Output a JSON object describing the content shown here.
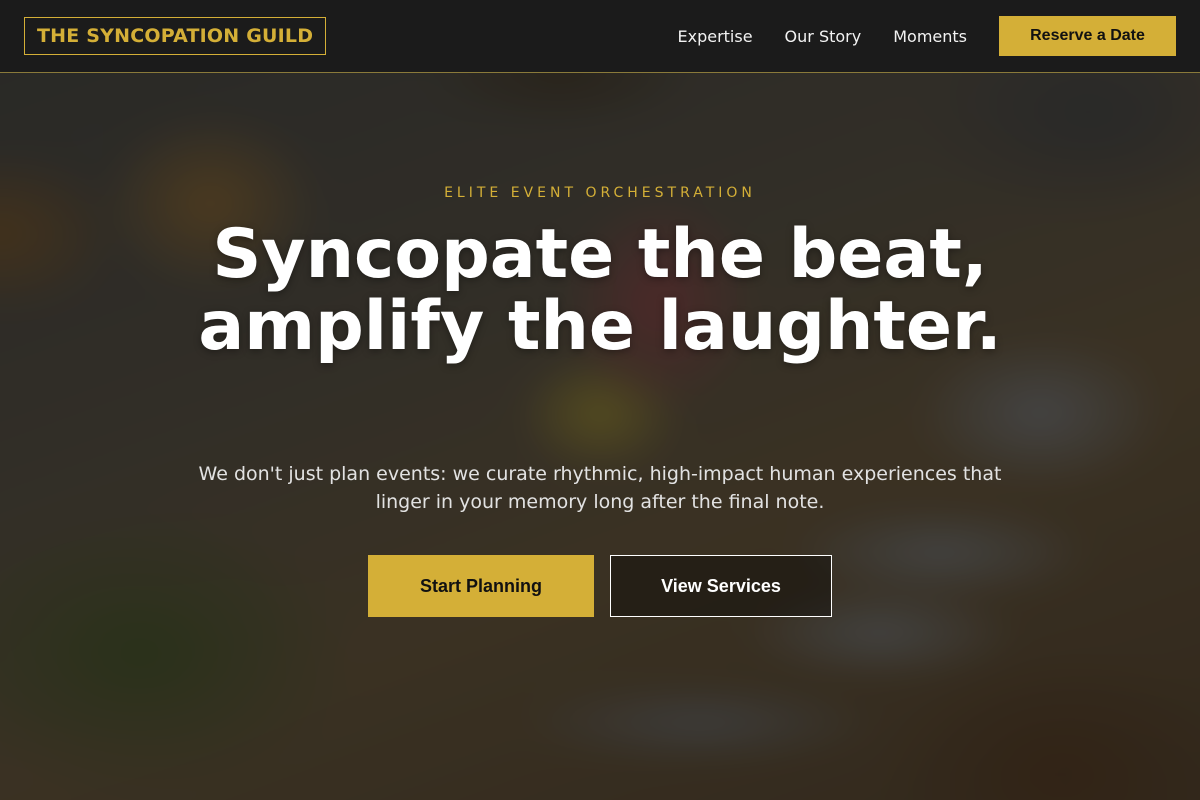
{
  "header": {
    "logo_text": "THE SYNCOPATION GUILD",
    "nav": [
      {
        "label": "Expertise"
      },
      {
        "label": "Our Story"
      },
      {
        "label": "Moments"
      }
    ],
    "reserve_label": "Reserve a Date"
  },
  "hero": {
    "eyebrow": "ELITE EVENT ORCHESTRATION",
    "headline": "Syncopate the beat, amplify the laughter.",
    "subtext": "We don't just plan events: we curate rhythmic, high-impact human experiences that linger in your memory long after the final note.",
    "primary_cta": "Start Planning",
    "secondary_cta": "View Services"
  },
  "colors": {
    "accent": "#d4af37",
    "header_bg": "#1b1b1b",
    "text_light": "#ffffff"
  }
}
